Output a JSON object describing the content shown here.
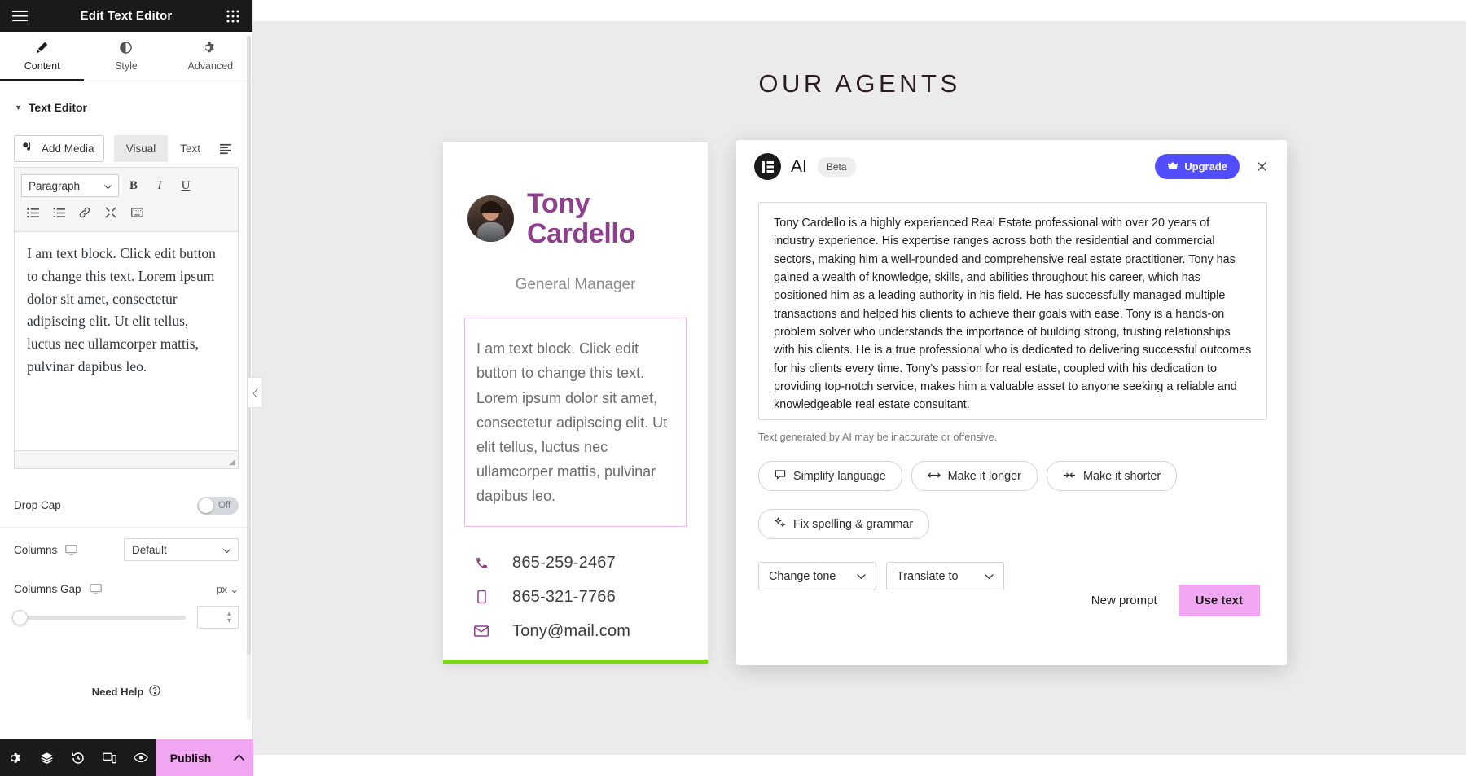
{
  "panel": {
    "header": {
      "title": "Edit Text Editor",
      "menu_icon": "hamburger-icon",
      "grid_icon": "apps-grid-icon"
    },
    "tabs": [
      {
        "label": "Content",
        "icon": "pencil-icon",
        "active": true
      },
      {
        "label": "Style",
        "icon": "contrast-icon",
        "active": false
      },
      {
        "label": "Advanced",
        "icon": "gear-icon",
        "active": false
      }
    ],
    "section_title": "Text Editor",
    "editor": {
      "add_media_label": "Add Media",
      "mode_tabs": [
        {
          "label": "Visual",
          "active": true
        },
        {
          "label": "Text",
          "active": false
        }
      ],
      "format_select": "Paragraph",
      "format_buttons": [
        "B",
        "I",
        "U"
      ],
      "row2_icons": [
        "unordered-list-icon",
        "ordered-list-icon",
        "link-icon",
        "fullscreen-icon",
        "keyboard-icon"
      ],
      "content": "I am text block. Click edit button to change this text. Lorem ipsum dolor sit amet, consectetur adipiscing elit. Ut elit tellus, luctus nec ullamcorper mattis, pulvinar dapibus leo."
    },
    "controls": {
      "drop_cap_label": "Drop Cap",
      "drop_cap_value": "Off",
      "columns_label": "Columns",
      "columns_value": "Default",
      "columns_gap_label": "Columns Gap",
      "columns_gap_unit": "px",
      "columns_gap_value": ""
    },
    "need_help": "Need Help",
    "footer": {
      "icons": [
        "settings-gear-icon",
        "layers-icon",
        "history-icon",
        "responsive-devices-icon",
        "preview-eye-icon"
      ],
      "publish_label": "Publish"
    }
  },
  "canvas": {
    "page_title": "OUR AGENTS",
    "agent_card": {
      "name_line1": "Tony",
      "name_line2": "Cardello",
      "role": "General Manager",
      "text_block": "I am text block. Click edit button to change this text. Lorem ipsum dolor sit amet, consectetur adipiscing elit. Ut elit tellus, luctus nec ullamcorper mattis, pulvinar dapibus leo.",
      "contacts": [
        {
          "icon": "phone-icon",
          "value": "865-259-2467"
        },
        {
          "icon": "mobile-icon",
          "value": "865-321-7766"
        },
        {
          "icon": "envelope-icon",
          "value": "Tony@mail.com"
        }
      ],
      "accent_color": "#8e3f8e",
      "bottom_bar_color": "#7ed321"
    }
  },
  "ai_dialog": {
    "logo_label": "elementor-logo-icon",
    "title": "AI",
    "badge": "Beta",
    "upgrade_label": "Upgrade",
    "upgrade_color": "#524cff",
    "close_icon": "close-icon",
    "result_text": "Tony Cardello is a highly experienced Real Estate professional with over 20 years of industry experience. His expertise ranges across both the residential and commercial sectors, making him a well-rounded and comprehensive real estate practitioner. Tony has gained a wealth of knowledge, skills, and abilities throughout his career, which has positioned him as a leading authority in his field. He has successfully managed multiple transactions and helped his clients to achieve their goals with ease. Tony is a hands-on problem solver who understands the importance of building strong, trusting relationships with his clients. He is a true professional who is dedicated to delivering successful outcomes for his clients every time. Tony's passion for real estate, coupled with his dedication to providing top-notch service, makes him a valuable asset to anyone seeking a reliable and knowledgeable real estate consultant.",
    "disclaimer": "Text generated by AI may be inaccurate or offensive.",
    "chips": [
      {
        "label": "Simplify language",
        "icon": "speech-bubble-icon"
      },
      {
        "label": "Make it longer",
        "icon": "arrows-expand-icon"
      },
      {
        "label": "Make it shorter",
        "icon": "arrows-collapse-icon"
      },
      {
        "label": "Fix spelling & grammar",
        "icon": "sparkle-icon"
      }
    ],
    "selects": [
      {
        "label": "Change tone"
      },
      {
        "label": "Translate to"
      }
    ],
    "new_prompt_label": "New prompt",
    "use_text_label": "Use text",
    "use_text_color": "#f0a6f0"
  }
}
